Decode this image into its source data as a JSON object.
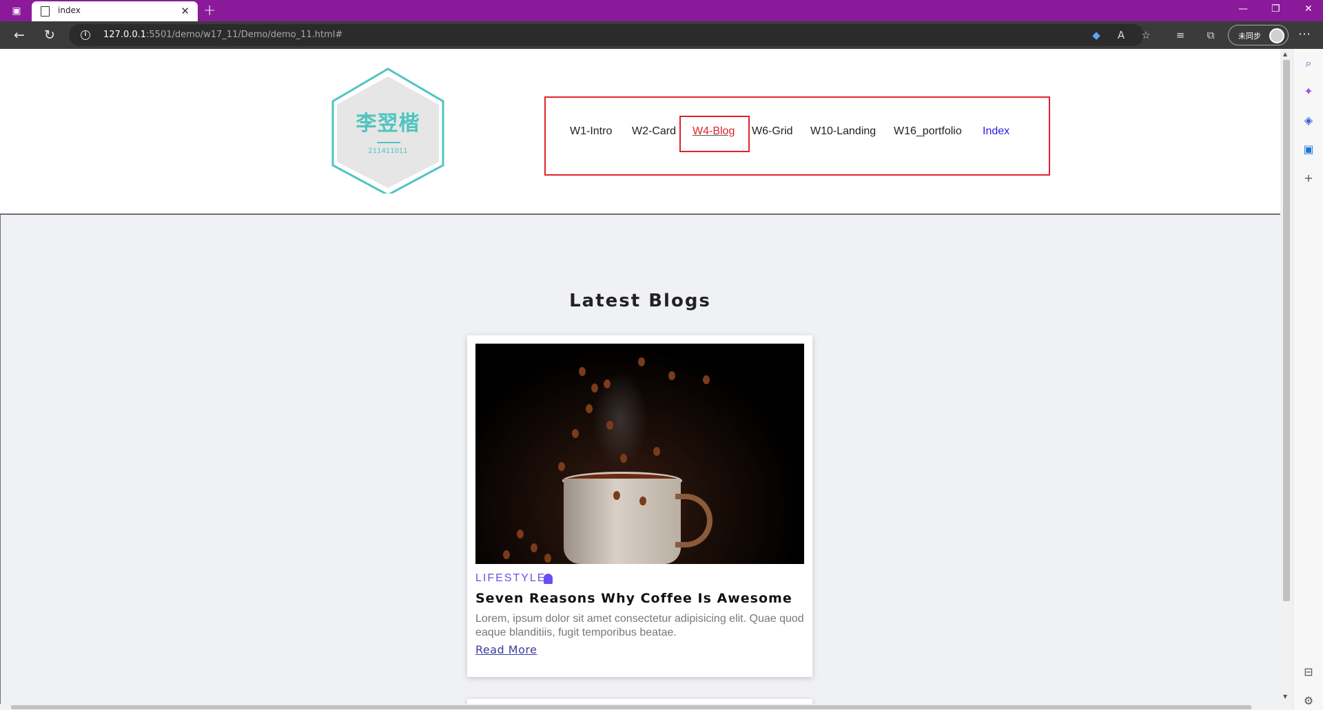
{
  "browser": {
    "tab_title": "index",
    "url_host": "127.0.0.1",
    "url_path": ":5501/demo/w17_11/Demo/demo_11.html#",
    "profile_label": "未同步",
    "accent_color": "#8a1a9a"
  },
  "header": {
    "logo_name": "李翌楷",
    "logo_id": "211411011",
    "logo_color": "#4ec5bf",
    "nav": [
      {
        "label": "W1-Intro"
      },
      {
        "label": "W2-Card"
      },
      {
        "label": "W4-Blog"
      },
      {
        "label": "W6-Grid"
      },
      {
        "label": "W10-Landing"
      },
      {
        "label": "W16_portfolio"
      },
      {
        "label": "Index"
      }
    ],
    "active_nav": "W4-Blog"
  },
  "main": {
    "section_title": "Latest Blogs",
    "cards": [
      {
        "category": "LIFESTYLE",
        "category_icon": "ghost-icon",
        "title": "Seven Reasons Why Coffee Is Awesome",
        "description": "Lorem, ipsum dolor sit amet consectetur adipisicing elit. Quae quod eaque blanditiis, fugit temporibus beatae.",
        "link": "Read More",
        "image_alt": "coffee cup with coffee beans"
      }
    ]
  }
}
